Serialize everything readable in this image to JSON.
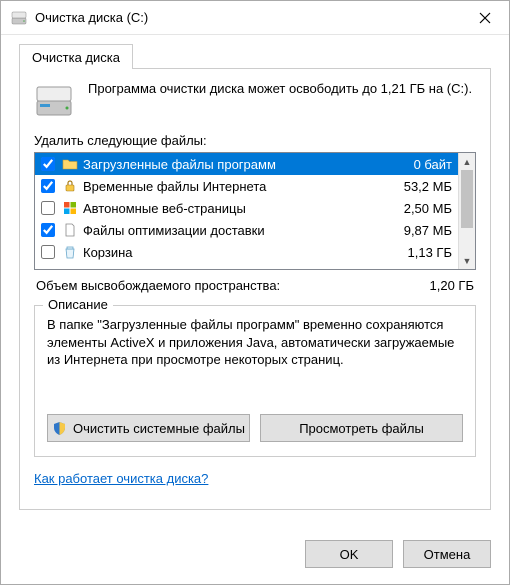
{
  "window": {
    "title": "Очистка диска  (C:)"
  },
  "tab": {
    "label": "Очистка диска"
  },
  "intro": "Программа очистки диска может освободить до 1,21 ГБ на (C:).",
  "deleteLabel": "Удалить следующие файлы:",
  "items": [
    {
      "checked": true,
      "icon": "folder",
      "name": "Загрузленные файлы программ",
      "size": "0 байт"
    },
    {
      "checked": true,
      "icon": "lock",
      "name": "Временные файлы Интернета",
      "size": "53,2 МБ"
    },
    {
      "checked": false,
      "icon": "windows",
      "name": "Автономные веб-страницы",
      "size": "2,50 МБ"
    },
    {
      "checked": true,
      "icon": "file",
      "name": "Файлы оптимизации доставки",
      "size": "9,87 МБ"
    },
    {
      "checked": false,
      "icon": "recycle",
      "name": "Корзина",
      "size": "1,13 ГБ"
    }
  ],
  "total": {
    "label": "Объем высвобождаемого пространства:",
    "value": "1,20 ГБ"
  },
  "description": {
    "title": "Описание",
    "text": "В папке \"Загрузленные файлы программ\" временно сохраняются элементы ActiveX и приложения Java, автоматически загружаемые из Интернета при просмотре некоторых страниц."
  },
  "buttons": {
    "cleanSystem": "Очистить системные файлы",
    "viewFiles": "Просмотреть файлы",
    "howItWorks": "Как работает очистка диска?",
    "ok": "OK",
    "cancel": "Отмена"
  }
}
